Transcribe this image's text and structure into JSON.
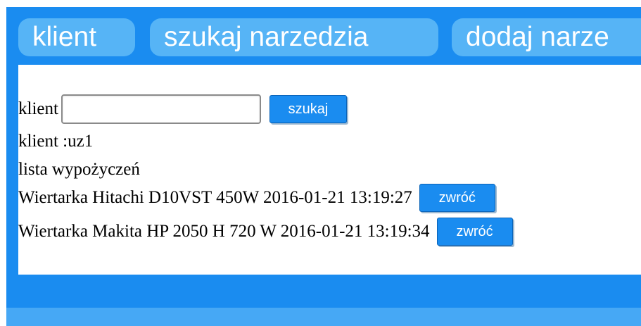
{
  "nav": {
    "tabs": [
      {
        "label": "klient"
      },
      {
        "label": "szukaj narzedzia"
      },
      {
        "label": "dodaj narze"
      }
    ]
  },
  "search": {
    "label": "klient",
    "value": "",
    "placeholder": "",
    "button_label": "szukaj"
  },
  "client": {
    "info": "klient :uz1"
  },
  "loans": {
    "title": "lista wypożyczeń",
    "items": [
      {
        "text": "Wiertarka Hitachi D10VST 450W 2016-01-21 13:19:27",
        "button_label": "zwróć"
      },
      {
        "text": "Wiertarka Makita HP 2050 H 720 W 2016-01-21 13:19:34",
        "button_label": "zwróć"
      }
    ]
  },
  "colors": {
    "frame": "#1a8cf0",
    "tab": "#56b4f6",
    "button": "#1a8cf0",
    "panel": "#ffffff"
  }
}
